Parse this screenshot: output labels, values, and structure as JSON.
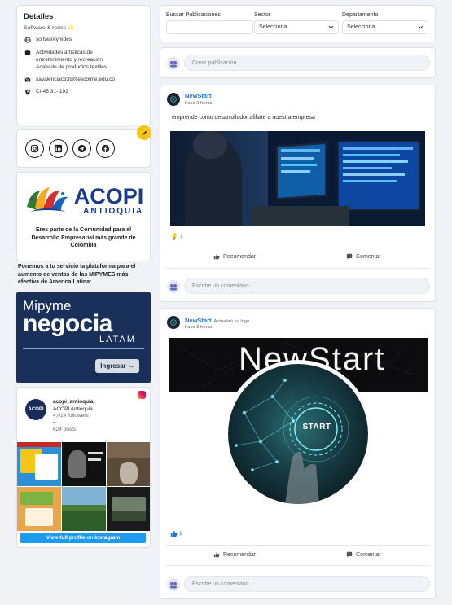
{
  "details": {
    "title": "Detalles",
    "subtitle": "Software & redes ✨",
    "website": "softwareyredes",
    "activity_line1": "Actividades artisticas de",
    "activity_line2": "entretenimiento y recreación",
    "activity_line3": "Acabado de productos textiles",
    "email": "savalenciac339@escolme.edu.co",
    "address": "Cr 45 31- 192"
  },
  "social": {
    "icons": [
      "instagram-icon",
      "linkedin-icon",
      "telegram-icon",
      "facebook-icon"
    ]
  },
  "acopi": {
    "name": "ACOPI",
    "region": "ANTIOQUIA",
    "caption_line1": "Eres parte de la Comunidad para el",
    "caption_line2": "Desarrollo Empresarial más grande de",
    "caption_line3": "Colombia"
  },
  "promo": {
    "line1": "Ponemos a tu servicio la plataforma para el",
    "line2": "aumento de ventas de las MIPYMES más",
    "line3": "efectiva de America Latina:"
  },
  "mipyme": {
    "line1": "Mipyme",
    "line2": "negocia",
    "line3": "LATAM",
    "button": "Ingresar →"
  },
  "instagram": {
    "avatar_text": "ACOPI",
    "handle": "acopi_antioquia",
    "name": "ACOPI Antioquia",
    "followers": "4,014 followers",
    "dot": "•",
    "posts": "624 posts",
    "button": "View full profile on Instagram"
  },
  "filters": {
    "search_label": "Buscar Publicaciones",
    "search_value": "",
    "sector_label": "Sector",
    "sector_value": "Selecciona...",
    "dept_label": "Departamento",
    "dept_value": "Selecciona..."
  },
  "composer": {
    "placeholder": "Crear publicación"
  },
  "post1": {
    "author": "NewStart",
    "time": "hace 2 horas",
    "text": "emprende como desarrollador afiliate a nuestra empresa",
    "reaction_count": "1",
    "recommend": "Recomendar",
    "comment": "Comentar",
    "comment_placeholder": "Escribe un comentario..."
  },
  "post2": {
    "author": "NewStart",
    "action": "Actualizó su logo",
    "time": "hace 3 horas",
    "logo_text": "START",
    "cover_text": "NewStart",
    "reaction_count": "1",
    "recommend": "Recomendar",
    "comment": "Comentar",
    "comment_placeholder": "Escribe un comentario..."
  },
  "colors": {
    "accent": "#1877f2",
    "background": "#f0f2f5",
    "edit_button": "#f5c518",
    "mipyme_bg": "#18305a"
  }
}
